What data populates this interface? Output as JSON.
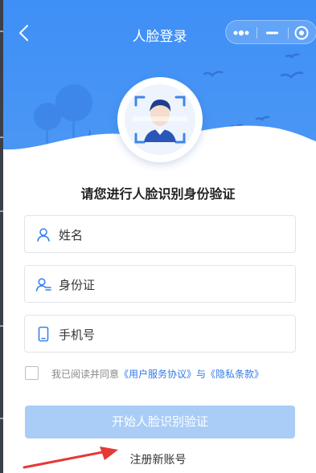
{
  "header": {
    "title": "人脸登录",
    "back_icon": "chevron-left-icon",
    "capsule_icons": [
      "more-dots-icon",
      "minimize-icon",
      "close-target-icon"
    ],
    "background_color": "#4291f5"
  },
  "main": {
    "subtitle": "请您进行人脸识别身份验证"
  },
  "form": {
    "fields": [
      {
        "label": "姓名",
        "icon": "user-icon"
      },
      {
        "label": "身份证",
        "icon": "id-card-icon"
      },
      {
        "label": "手机号",
        "icon": "phone-icon"
      }
    ],
    "agreement": {
      "prefix": "我已阅读并同意",
      "service_link": "《用户服务协议》",
      "joiner": "与",
      "privacy_link": "《隐私条款》"
    },
    "submit_label": "开始人脸识别验证",
    "register_label": "注册新账号"
  },
  "colors": {
    "accent": "#2f7be8",
    "button_disabled": "#a9cdf7",
    "annotation_arrow": "#e53935"
  }
}
